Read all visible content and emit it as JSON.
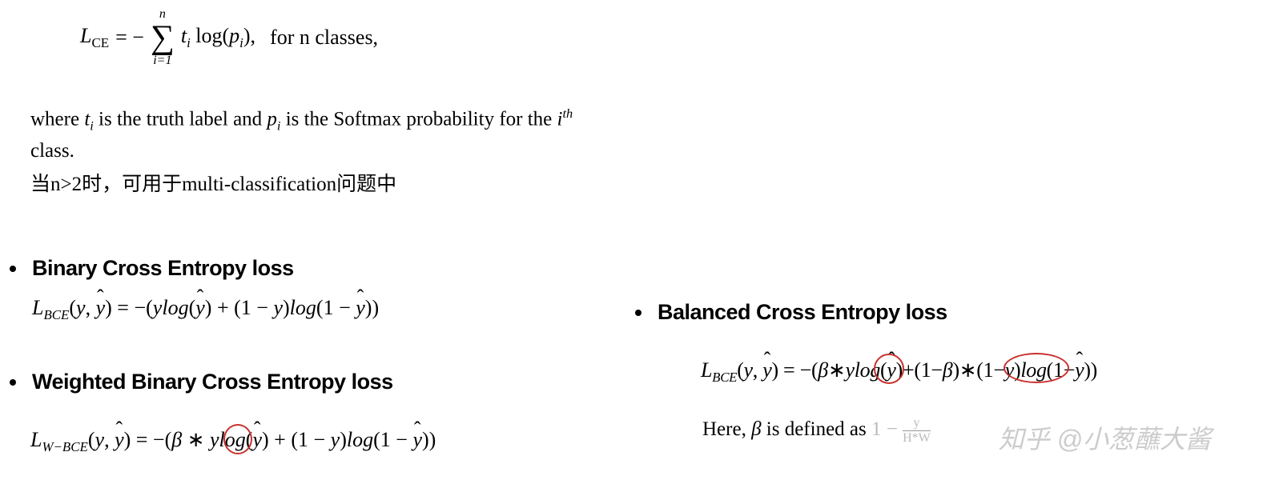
{
  "formula_ce": {
    "lhs_L": "L",
    "lhs_sub": "CE",
    "eq": " = −",
    "sum_top": "n",
    "sum_bot": "i=1",
    "term_t": "t",
    "term_ti_sub": "i",
    "log": " log(",
    "term_p": "p",
    "term_pi_sub": "i",
    "close": "),",
    "tail": " for n classes,"
  },
  "where_line": {
    "p1": "where ",
    "ti_t": "t",
    "ti_i": "i",
    "p2": " is the truth label and ",
    "pi_p": "p",
    "pi_i": "i",
    "p3": " is the Softmax probability for the ",
    "ith_i": "i",
    "ith_th": "th",
    "p4": " class."
  },
  "cn_note": "当n>2时，可用于multi-classification问题中",
  "section_bce": {
    "title": "Binary Cross Entropy loss",
    "formula": "L_{BCE}(y, \\hat{y}) = -(y log(\\hat{y}) + (1 - y) log(1 - \\hat{y}))"
  },
  "section_wbce": {
    "title": "Weighted Binary Cross Entropy loss",
    "formula": "L_{W-BCE}(y, \\hat{y}) = -(\\beta * y log(\\hat{y}) + (1 - y) log(1 - \\hat{y}))"
  },
  "section_balanced": {
    "title": "Balanced Cross Entropy loss",
    "formula": "L_{BCE}(y, \\hat{y}) = -(\\beta * y log(\\hat{y}) + (1-\\beta) * (1-y) log(1-\\hat{y}))"
  },
  "beta_explain": {
    "p1": "Here, ",
    "beta": "β",
    "p2": " is defined as ",
    "frac_top": "y",
    "frac_bot": "H*W",
    "prefix": "1 − "
  },
  "watermark": "知乎 @小葱蘸大酱"
}
